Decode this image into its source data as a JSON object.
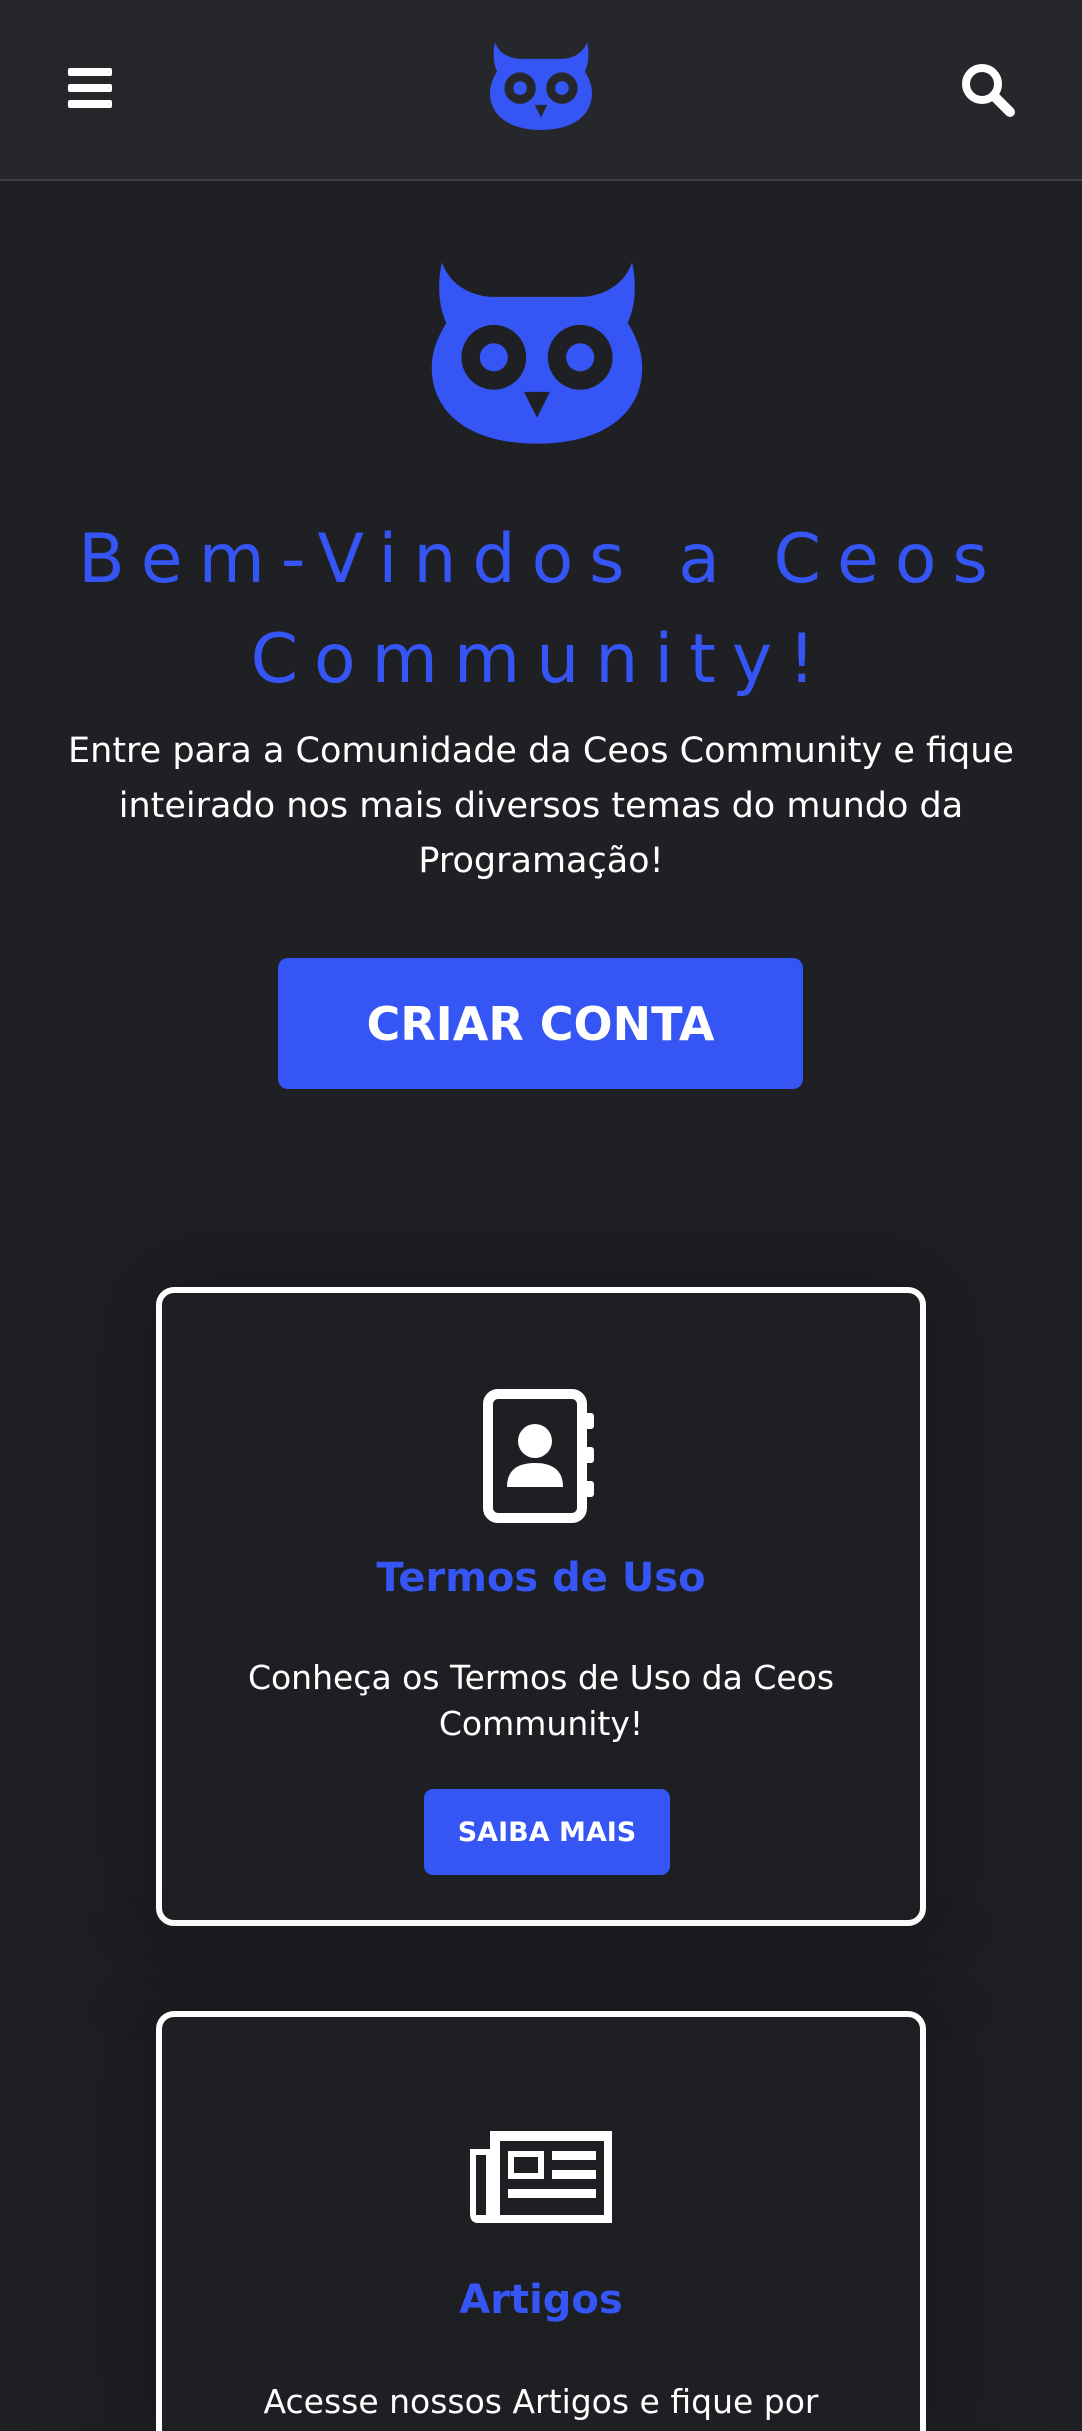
{
  "header": {
    "menu_icon": "hamburger-menu-icon",
    "logo_icon": "owl-logo-icon",
    "search_icon": "search-icon"
  },
  "hero": {
    "logo_icon": "owl-logo-icon",
    "title": "Bem-Vindos a Ceos Community!",
    "subtitle": "Entre para a Comunidade da Ceos Community e fique inteirado nos mais diversos temas do mundo da Programação!",
    "cta_label": "CRIAR CONTA"
  },
  "cards": [
    {
      "icon": "address-book-icon",
      "title": "Termos de Uso",
      "text": "Conheça os Termos de Uso da Ceos Community!",
      "button_label": "SAIBA MAIS"
    },
    {
      "icon": "newspaper-icon",
      "title": "Artigos",
      "text": "Acesse nossos Artigos e fique por"
    }
  ],
  "colors": {
    "accent": "#3555f5",
    "background": "#1f2024",
    "header_background": "#26272a",
    "text": "#ffffff"
  }
}
